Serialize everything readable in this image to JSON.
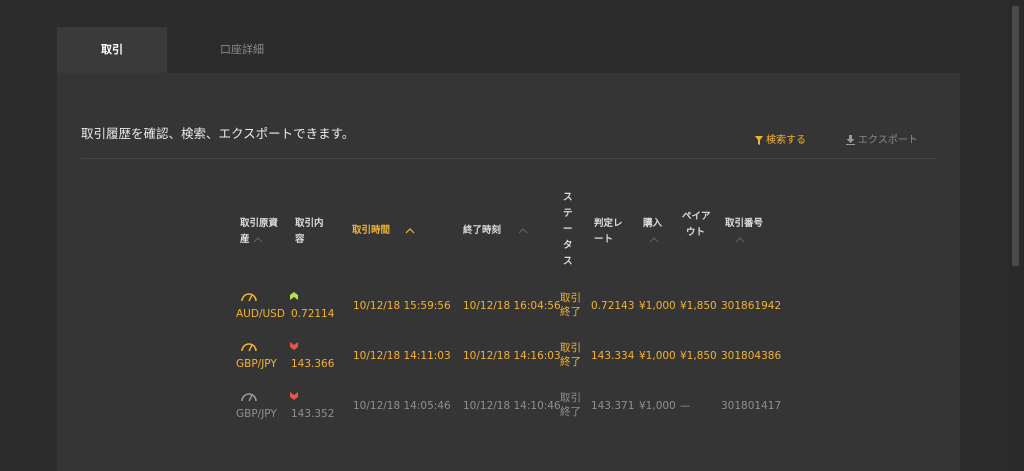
{
  "tabs": [
    {
      "label": "取引"
    },
    {
      "label": "口座詳細"
    }
  ],
  "intro": "取引履歴を確認、検索、エクスポートできます。",
  "actions": {
    "search": "検索する",
    "export": "エクスポート"
  },
  "columns": {
    "asset": [
      "取引原資",
      "産"
    ],
    "content": [
      "取引内",
      "容"
    ],
    "trade_time": "取引時間",
    "end_time": "終了時刻",
    "status": [
      "ス",
      "テ",
      "ー",
      "タ",
      "ス"
    ],
    "strike": [
      "判定レ",
      "ート"
    ],
    "purchase": "購入",
    "payout": [
      "ペイア",
      "ウト"
    ],
    "trade_no": "取引番号"
  },
  "rows": [
    {
      "asset": "AUD/USD",
      "direction": "up",
      "rate": "0.72114",
      "trade_time": "10/12/18 15:59:56",
      "end_time": "10/12/18 16:04:56",
      "status": [
        "取引",
        "終了"
      ],
      "strike": "0.72143",
      "purchase": "¥1,000",
      "payout": "¥1,850",
      "trade_no": "301861942"
    },
    {
      "asset": "GBP/JPY",
      "direction": "down",
      "rate": "143.366",
      "trade_time": "10/12/18 14:11:03",
      "end_time": "10/12/18 14:16:03",
      "status": [
        "取引",
        "終了"
      ],
      "strike": "143.334",
      "purchase": "¥1,000",
      "payout": "¥1,850",
      "trade_no": "301804386"
    },
    {
      "asset": "GBP/JPY",
      "direction": "down",
      "rate": "143.352",
      "trade_time": "10/12/18 14:05:46",
      "end_time": "10/12/18 14:10:46",
      "status": [
        "取引",
        "終了"
      ],
      "strike": "143.371",
      "purchase": "¥1,000",
      "payout": "—",
      "trade_no": "301801417"
    }
  ],
  "colors": {
    "accent": "#f2b233",
    "up": "#b8e04a",
    "down": "#e8554a",
    "muted": "#8f8f8f"
  }
}
